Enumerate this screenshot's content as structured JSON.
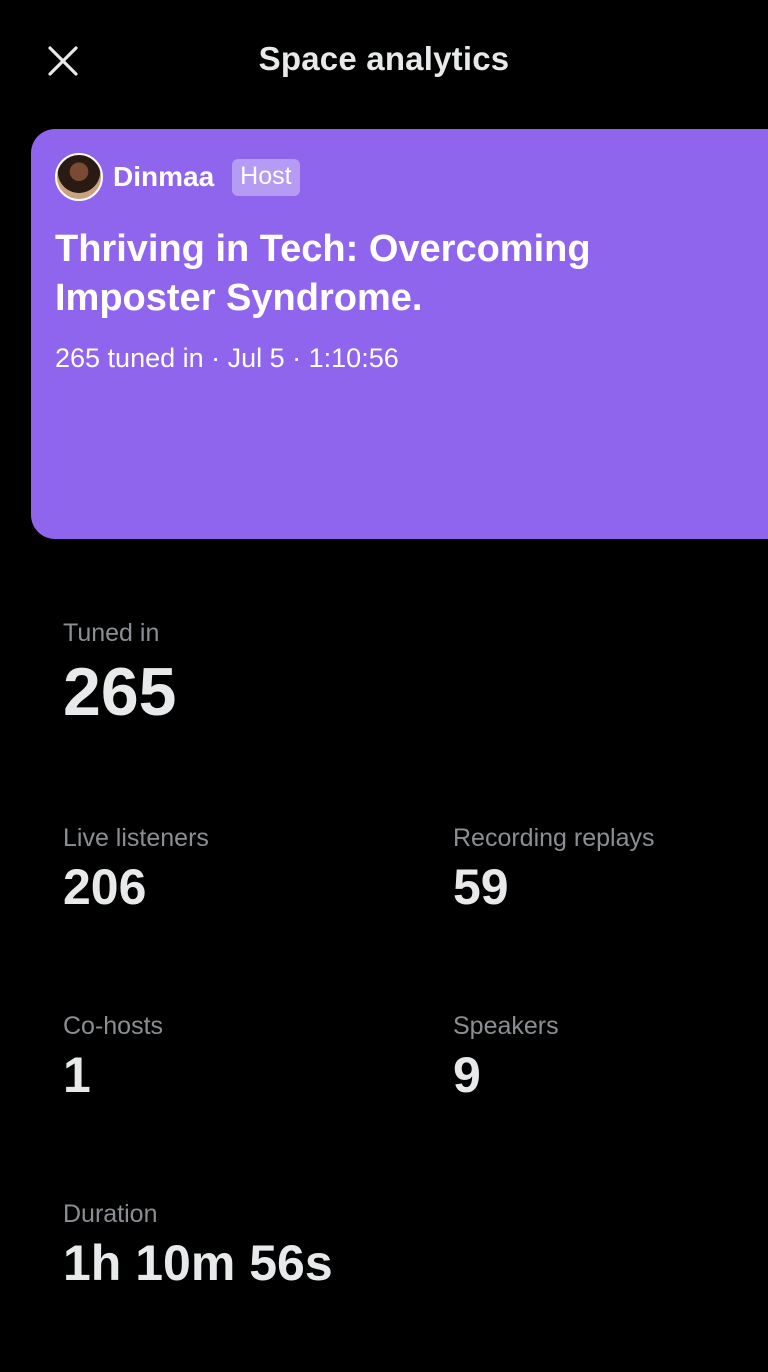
{
  "header": {
    "title": "Space analytics",
    "close_icon": "close-icon"
  },
  "space": {
    "card_color": "#9065ee",
    "host": {
      "name": "Dinmaa",
      "badge": "Host"
    },
    "title": "Thriving in Tech: Overcoming Imposter Syndrome.",
    "meta": "265 tuned in · Jul 5 · 1:10:56"
  },
  "stats": {
    "tuned_in": {
      "label": "Tuned in",
      "value": "265"
    },
    "live_listeners": {
      "label": "Live listeners",
      "value": "206"
    },
    "recording_replays": {
      "label": "Recording replays",
      "value": "59"
    },
    "co_hosts": {
      "label": "Co-hosts",
      "value": "1"
    },
    "speakers": {
      "label": "Speakers",
      "value": "9"
    },
    "duration": {
      "label": "Duration",
      "value": "1h 10m 56s"
    }
  }
}
